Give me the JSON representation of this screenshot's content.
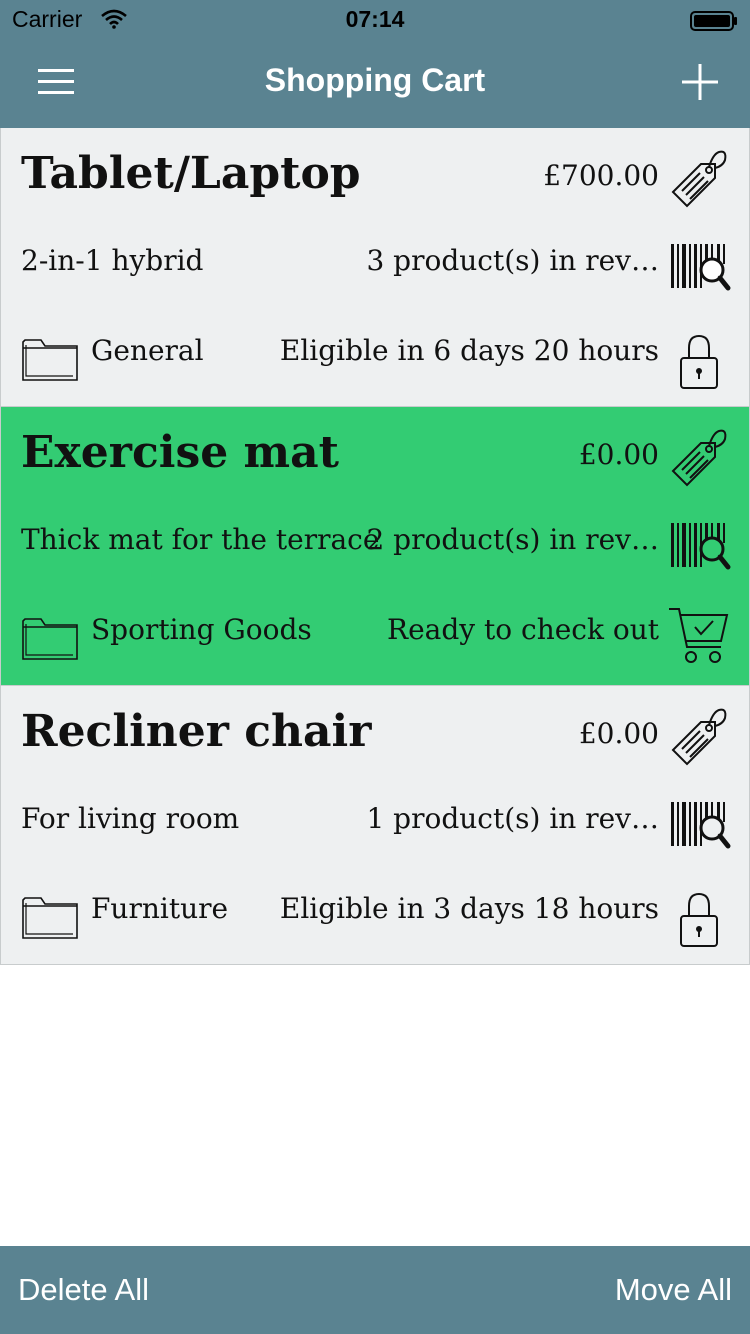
{
  "status_bar": {
    "carrier": "Carrier",
    "time": "07:14"
  },
  "nav": {
    "title": "Shopping Cart",
    "menu_icon": "hamburger-menu-icon",
    "add_icon": "plus-icon"
  },
  "carts": [
    {
      "name": "Tablet/Laptop",
      "price": "£700.00",
      "description": "2-in-1 hybrid",
      "reviews": "3 product(s) in rev…",
      "category": "General",
      "status": "Eligible in 6 days 20 hours",
      "status_icon": "lock-icon",
      "background": "#eef0f1"
    },
    {
      "name": "Exercise mat",
      "price": "£0.00",
      "description": "Thick mat for the terrace",
      "reviews": "2 product(s) in rev…",
      "category": "Sporting Goods",
      "status": "Ready to check out",
      "status_icon": "cart-check-icon",
      "background": "#33cc73"
    },
    {
      "name": "Recliner chair",
      "price": "£0.00",
      "description": "For living room",
      "reviews": "1 product(s) in rev…",
      "category": "Furniture",
      "status": "Eligible in 3 days 18 hours",
      "status_icon": "lock-icon",
      "background": "#eef0f1"
    }
  ],
  "toolbar": {
    "delete_all": "Delete All",
    "move_all": "Move All"
  },
  "colors": {
    "bar": "#5a8391",
    "ready": "#33cc73",
    "card": "#eef0f1"
  }
}
